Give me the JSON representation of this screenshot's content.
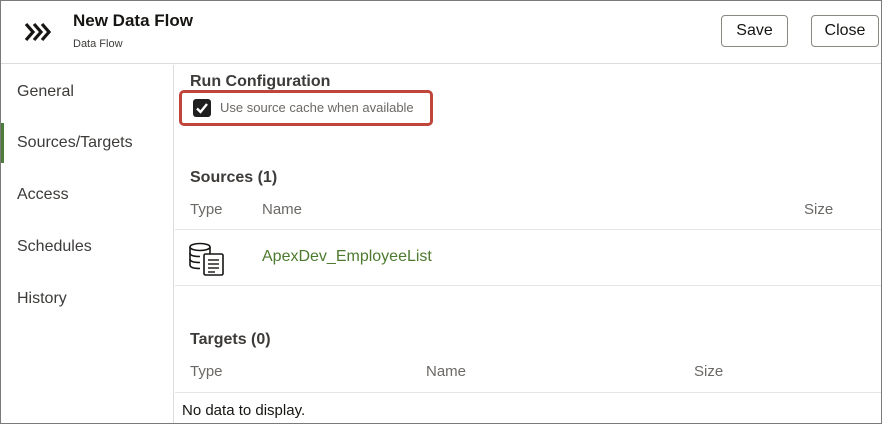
{
  "header": {
    "title": "New Data Flow",
    "subtitle": "Data Flow",
    "save_label": "Save",
    "close_label": "Close",
    "app_icon": "triple-chevron-right-icon"
  },
  "sidebar": {
    "items": [
      {
        "label": "General",
        "active": false
      },
      {
        "label": "Sources/Targets",
        "active": true
      },
      {
        "label": "Access",
        "active": false
      },
      {
        "label": "Schedules",
        "active": false
      },
      {
        "label": "History",
        "active": false
      }
    ],
    "active_color": "#4d7c3a"
  },
  "main": {
    "run_config": {
      "title": "Run Configuration",
      "use_cache_label": "Use source cache when available",
      "use_cache_checked": true,
      "highlight_color": "#c0463c"
    },
    "sources": {
      "title": "Sources (1)",
      "columns": [
        "Type",
        "Name",
        "Size"
      ],
      "rows": [
        {
          "type_icon": "database-document-icon",
          "name": "ApexDev_EmployeeList",
          "size": ""
        }
      ]
    },
    "targets": {
      "title": "Targets (0)",
      "columns": [
        "Type",
        "Name",
        "Size"
      ],
      "empty_text": "No data to display."
    }
  }
}
